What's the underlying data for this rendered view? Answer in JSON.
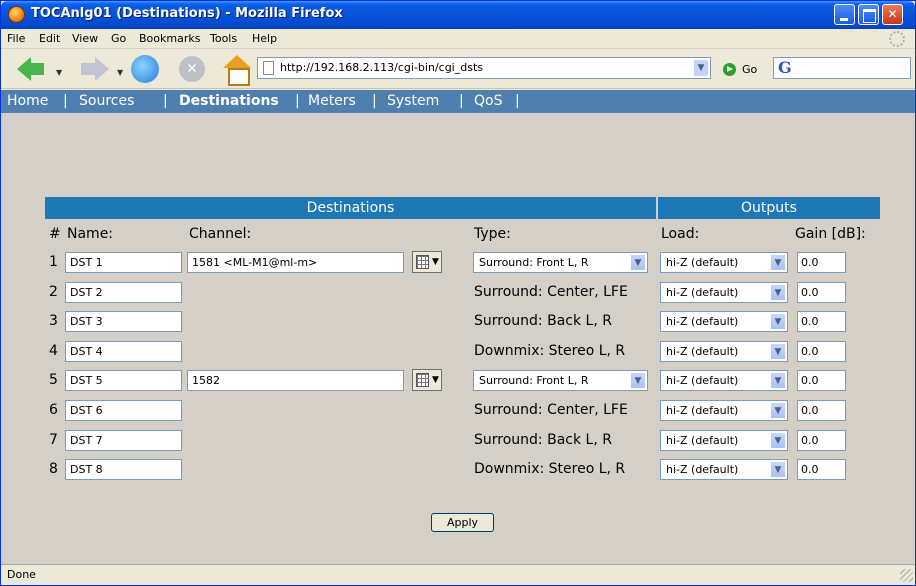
{
  "window": {
    "title": "TOCAnlg01 (Destinations) - Mozilla Firefox"
  },
  "menu": [
    "File",
    "Edit",
    "View",
    "Go",
    "Bookmarks",
    "Tools",
    "Help"
  ],
  "toolbar": {
    "url": "http://192.168.2.113/cgi-bin/cgi_dsts",
    "go_label": "Go",
    "search_logo": "G"
  },
  "nav": {
    "items": [
      "Home",
      "Sources",
      "Destinations",
      "Meters",
      "System",
      "QoS"
    ],
    "separator": "|",
    "active": "Destinations"
  },
  "table": {
    "section_destinations": "Destinations",
    "section_outputs": "Outputs",
    "headers": {
      "num": "#",
      "name": "Name:",
      "channel": "Channel:",
      "type": "Type:",
      "load": "Load:",
      "gain": "Gain [dB]:"
    },
    "rows": [
      {
        "num": "1",
        "name": "DST 1",
        "channel": "1581 <ML-M1@ml-m>",
        "type": "Surround: Front L, R",
        "type_is_select": true,
        "load": "hi-Z (default)",
        "gain": "0.0"
      },
      {
        "num": "2",
        "name": "DST 2",
        "channel": "",
        "type": "Surround: Center, LFE",
        "type_is_select": false,
        "load": "hi-Z (default)",
        "gain": "0.0"
      },
      {
        "num": "3",
        "name": "DST 3",
        "channel": "",
        "type": "Surround: Back L, R",
        "type_is_select": false,
        "load": "hi-Z (default)",
        "gain": "0.0"
      },
      {
        "num": "4",
        "name": "DST 4",
        "channel": "",
        "type": "Downmix: Stereo L, R",
        "type_is_select": false,
        "load": "hi-Z (default)",
        "gain": "0.0"
      },
      {
        "num": "5",
        "name": "DST 5",
        "channel": "1582",
        "type": "Surround: Front L, R",
        "type_is_select": true,
        "load": "hi-Z (default)",
        "gain": "0.0"
      },
      {
        "num": "6",
        "name": "DST 6",
        "channel": "",
        "type": "Surround: Center, LFE",
        "type_is_select": false,
        "load": "hi-Z (default)",
        "gain": "0.0"
      },
      {
        "num": "7",
        "name": "DST 7",
        "channel": "",
        "type": "Surround: Back L, R",
        "type_is_select": false,
        "load": "hi-Z (default)",
        "gain": "0.0"
      },
      {
        "num": "8",
        "name": "DST 8",
        "channel": "",
        "type": "Downmix: Stereo L, R",
        "type_is_select": false,
        "load": "hi-Z (default)",
        "gain": "0.0"
      }
    ]
  },
  "apply_label": "Apply",
  "status": "Done",
  "colors": {
    "nav_bg": "#4f7fae",
    "header_bg": "#1f78b6",
    "content_bg": "#d4d0c8"
  },
  "icons": [
    "firefox-icon",
    "back-arrow-icon",
    "forward-arrow-icon",
    "reload-icon",
    "stop-icon",
    "home-icon",
    "page-icon",
    "go-icon",
    "google-icon",
    "channel-picker-icon",
    "resize-grip-icon"
  ]
}
